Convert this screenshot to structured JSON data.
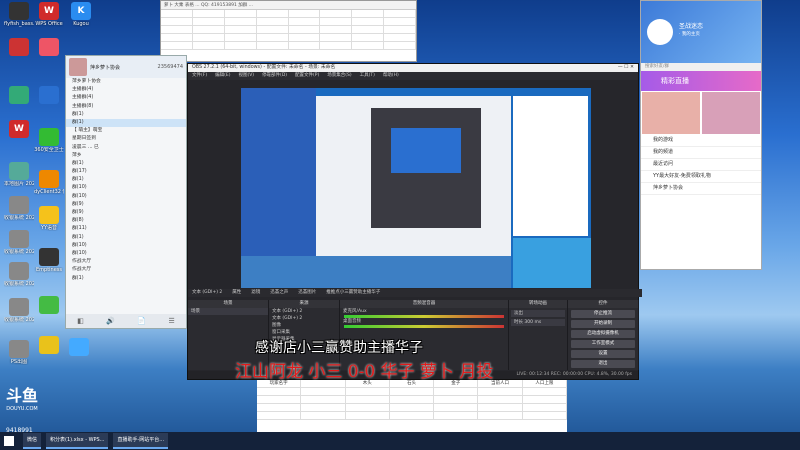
{
  "desktop": {
    "icons": [
      {
        "label": "flyfish_bass...",
        "color": "#333"
      },
      {
        "label": "WPS Office",
        "color": "#d02b2b",
        "glyph": "W"
      },
      {
        "label": "Kugou",
        "color": "#2a8cf0",
        "glyph": "K"
      },
      {
        "label": "",
        "color": "#c33"
      },
      {
        "label": "",
        "color": "#e56"
      },
      {
        "label": "",
        "color": "#3a7"
      },
      {
        "label": "",
        "color": "#2a6fd0"
      },
      {
        "label": "",
        "color": "#d02b2b",
        "glyph": "W"
      },
      {
        "label": "本地图片 20220...",
        "color": "#5a9"
      },
      {
        "label": "360安全卫士",
        "color": "#3b3"
      },
      {
        "label": "收银系统 20220...",
        "color": "#888"
      },
      {
        "label": "dyClient32 快捷方式",
        "color": "#e80"
      },
      {
        "label": "收银系统 20220...",
        "color": "#888"
      },
      {
        "label": "YY语音",
        "color": "#f5c21b"
      },
      {
        "label": "收银系统 20220...",
        "color": "#888"
      },
      {
        "label": "Emptiness",
        "color": "#333"
      },
      {
        "label": "收银系统 20220...",
        "color": "#888"
      },
      {
        "label": "",
        "color": "#4b4"
      },
      {
        "label": "PS出图",
        "color": "#888"
      },
      {
        "label": "",
        "color": "#e9c21b"
      },
      {
        "label": "",
        "color": "#4af"
      }
    ],
    "douyu_logo": "斗鱼",
    "douyu_sub": "DOUYU.COM",
    "room_id": "9418991"
  },
  "sheet": {
    "title": "萝卜 大乘 表格 ...  QQ: 419153891 加群 ...",
    "headers": [
      "",
      "",
      "",
      "",
      "",
      "",
      "",
      ""
    ],
    "rows": [
      [
        "",
        "",
        "",
        "",
        "",
        "",
        "",
        ""
      ],
      [
        "",
        "",
        "",
        "",
        "",
        "",
        "",
        ""
      ],
      [
        "",
        "",
        "",
        "",
        "",
        "",
        "",
        ""
      ],
      [
        "",
        "",
        "",
        "",
        "",
        "",
        "",
        ""
      ]
    ]
  },
  "chat": {
    "title": "萍乡萝卜协会",
    "subtitle": "23569474",
    "items": [
      "萍乡萝卜协会",
      "主播群(4)",
      "主播群(4)",
      "主播群(8)",
      "群(1)",
      "群(1)",
      "【 萌主】萌宝",
      "星期日签到",
      "凌晨三 ... 已",
      "萍乡",
      "群(1)",
      "群(17)",
      "群(1)",
      "群(10)",
      "群(10)",
      "群(9)",
      "群(9)",
      "群(8)",
      "群(11)",
      "群(1)",
      "群(10)",
      "群(10)",
      "作战大厅",
      "作战大厅",
      "群(1)"
    ],
    "selected_index": 5,
    "footer_icons": [
      "◧",
      "🔊",
      "📄",
      "☰"
    ]
  },
  "obs": {
    "title": "OBS 27.2.1 (64-bit, windows) - 配置文件: 未命名 - 场景: 未命名",
    "menu": [
      "文件(F)",
      "编辑(E)",
      "视图(V)",
      "停靠部件(D)",
      "配置文件(P)",
      "场景集合(S)",
      "工具(T)",
      "帮助(H)"
    ],
    "source_bar": [
      "文本 (GDI+) 2",
      "属性",
      "滤镜",
      "迅荟之声",
      "迅荟图片",
      "推推点小三赢赞助主播华子"
    ],
    "docks": {
      "scenes": {
        "title": "场景",
        "items": [
          "场景"
        ]
      },
      "sources": {
        "title": "来源",
        "items": [
          "文本 (GDI+) 2",
          "文本 (GDI+) 2",
          "图像",
          "窗口采集",
          "显示器采集"
        ]
      },
      "mixer": {
        "title": "音频混音器",
        "rows": [
          "麦克风/Aux",
          "桌面音频"
        ]
      },
      "transitions": {
        "title": "转场动画",
        "items": [
          "淡出",
          "时长 300 ms"
        ]
      },
      "controls": {
        "title": "控件",
        "buttons": [
          "停止推流",
          "开始录制",
          "启动虚拟摄像机",
          "工作室模式",
          "设置",
          "退出"
        ]
      }
    },
    "status": "LIVE: 00:12:34  REC: 00:00:00  CPU: 4.8%, 30.00 fps"
  },
  "yy": {
    "name": "圣战迷恋",
    "status": "· 我的主页",
    "search_placeholder": "搜索好友/群",
    "banner": "精彩直播",
    "list": [
      "我的游戏",
      "我的频道",
      "最近访问",
      "YY最大好友-免费领取礼物",
      "萍乡萝卜协会"
    ]
  },
  "overlay": {
    "caption_white": "感谢店小三赢赞助主播华子",
    "caption_red": "江山阿龙 小三 0-0 华子 萝卜 月投"
  },
  "table2": {
    "headers": [
      "玩家名字",
      "",
      "木头",
      "石头",
      "金子",
      "当前人口",
      "人口上限"
    ]
  },
  "taskbar": {
    "items": [
      "微信",
      "积分表(1).xlsx - WPS...",
      "直播助手-网站平台..."
    ]
  }
}
